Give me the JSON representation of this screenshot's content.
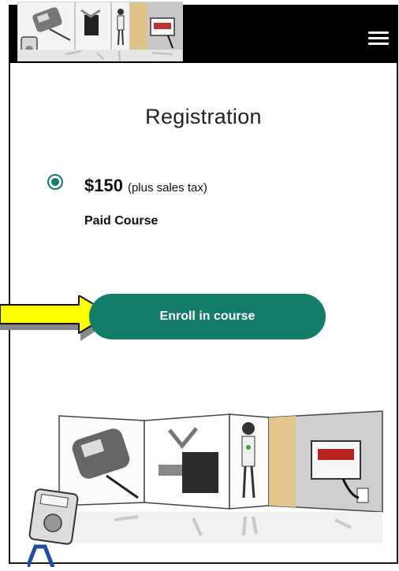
{
  "header": {
    "menu_icon": "hamburger-menu-icon"
  },
  "registration": {
    "title": "Registration",
    "price": "$150",
    "tax_note": "(plus sales tax)",
    "course_type": "Paid Course",
    "option_selected": true
  },
  "actions": {
    "enroll_label": "Enroll in course"
  },
  "colors": {
    "accent": "#137d6a",
    "header_bg": "#000000",
    "arrow": "#ffff00"
  }
}
